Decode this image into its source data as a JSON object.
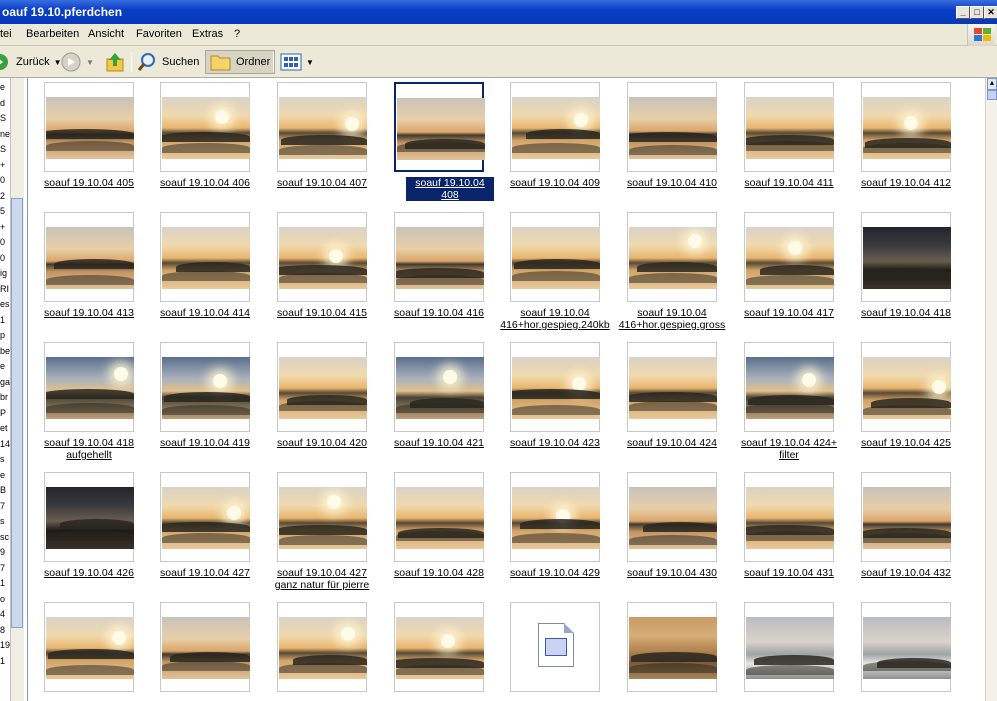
{
  "window": {
    "title": "oauf 19.10.pferdchen"
  },
  "menu": [
    "tei",
    "Bearbeiten",
    "Ansicht",
    "Favoriten",
    "Extras",
    "?"
  ],
  "toolbar": {
    "back_label": "Zurück",
    "search_label": "Suchen",
    "folders_label": "Ordner"
  },
  "left_pane": {
    "labels": [
      "e",
      "d",
      "S",
      "ne",
      "S",
      "+",
      "0",
      "2",
      "5",
      "+",
      "0",
      "0",
      "ig",
      "RI",
      "es",
      "1",
      "p",
      "be",
      "e",
      "ga",
      "br",
      "P",
      "et",
      "14",
      "s",
      "e",
      "B",
      "7",
      "s",
      "sc",
      "9",
      "7",
      "1",
      "o",
      "4",
      "8",
      "19",
      "1"
    ]
  },
  "items": [
    {
      "label": "soauf 19.10.04 405",
      "style": "warm"
    },
    {
      "label": "soauf 19.10.04 406",
      "style": "gold"
    },
    {
      "label": "soauf 19.10.04 407",
      "style": "gold"
    },
    {
      "label": "soauf 19.10.04 408",
      "style": "warm",
      "selected": true
    },
    {
      "label": "soauf 19.10.04 409",
      "style": "gold"
    },
    {
      "label": "soauf 19.10.04 410",
      "style": "warm"
    },
    {
      "label": "soauf 19.10.04 411",
      "style": "gold"
    },
    {
      "label": "soauf 19.10.04 412",
      "style": "gold"
    },
    {
      "label": "soauf 19.10.04 413",
      "style": "warm"
    },
    {
      "label": "soauf 19.10.04 414",
      "style": "gold"
    },
    {
      "label": "soauf 19.10.04 415",
      "style": "gold"
    },
    {
      "label": "soauf 19.10.04 416",
      "style": "warm"
    },
    {
      "label": "soauf 19.10.04 416+hor.gespieg.240kb",
      "style": "gold"
    },
    {
      "label": "soauf 19.10.04 416+hor.gespieg.gross",
      "style": "gold"
    },
    {
      "label": "soauf 19.10.04 417",
      "style": "gold"
    },
    {
      "label": "soauf 19.10.04 418",
      "style": "dark"
    },
    {
      "label": "soauf 19.10.04 418 aufgehellt",
      "style": "blue"
    },
    {
      "label": "soauf 19.10.04 419",
      "style": "blue"
    },
    {
      "label": "soauf 19.10.04 420",
      "style": "gold"
    },
    {
      "label": "soauf 19.10.04 421",
      "style": "blue"
    },
    {
      "label": "soauf 19.10.04 423",
      "style": "gold"
    },
    {
      "label": "soauf 19.10.04 424",
      "style": "gold"
    },
    {
      "label": "soauf 19.10.04 424+ filter",
      "style": "blue"
    },
    {
      "label": "soauf 19.10.04 425",
      "style": "gold"
    },
    {
      "label": "soauf 19.10.04 426",
      "style": "dark"
    },
    {
      "label": "soauf 19.10.04 427",
      "style": "gold"
    },
    {
      "label": "soauf 19.10.04 427 ganz natur für pierre",
      "style": "gold"
    },
    {
      "label": "soauf 19.10.04 428",
      "style": "gold"
    },
    {
      "label": "soauf 19.10.04 429",
      "style": "gold"
    },
    {
      "label": "soauf 19.10.04 430",
      "style": "warm"
    },
    {
      "label": "soauf 19.10.04 431",
      "style": "gold"
    },
    {
      "label": "soauf 19.10.04 432",
      "style": "warm"
    },
    {
      "label": "",
      "style": "gold"
    },
    {
      "label": "",
      "style": "warm"
    },
    {
      "label": "",
      "style": "gold"
    },
    {
      "label": "",
      "style": "gold"
    },
    {
      "label": "",
      "style": "file"
    },
    {
      "label": "",
      "style": "sepia"
    },
    {
      "label": "",
      "style": "mist"
    },
    {
      "label": "",
      "style": "mist"
    }
  ]
}
